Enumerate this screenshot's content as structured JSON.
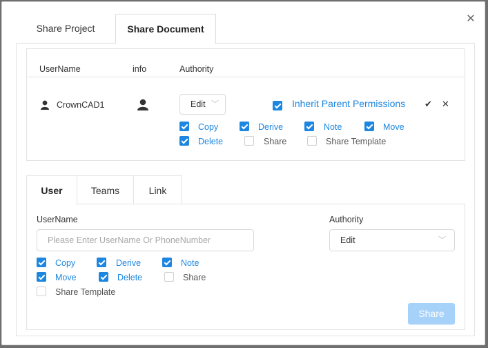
{
  "dialog": {
    "close_icon": "close-icon",
    "tabs": [
      "Share Project",
      "Share Document"
    ],
    "active_tab": "Share Document"
  },
  "permissions_table": {
    "headers": {
      "username": "UserName",
      "info": "info",
      "authority": "Authority"
    },
    "row": {
      "username": "CrownCAD1",
      "authority": "Edit",
      "inherit_label": "Inherit Parent Permissions",
      "inherit_checked": true,
      "checkboxes": [
        {
          "label": "Copy",
          "checked": true
        },
        {
          "label": "Derive",
          "checked": true
        },
        {
          "label": "Note",
          "checked": true
        },
        {
          "label": "Move",
          "checked": true
        },
        {
          "label": "Delete",
          "checked": true
        },
        {
          "label": "Share",
          "checked": false
        },
        {
          "label": "Share Template",
          "checked": false
        }
      ]
    }
  },
  "share_form": {
    "tabs": [
      "User",
      "Teams",
      "Link"
    ],
    "active_tab": "User",
    "username_label": "UserName",
    "username_placeholder": "Please Enter UserName Or PhoneNumber",
    "username_value": "",
    "authority_label": "Authority",
    "authority_value": "Edit",
    "checkboxes": [
      {
        "label": "Copy",
        "checked": true
      },
      {
        "label": "Derive",
        "checked": true
      },
      {
        "label": "Note",
        "checked": true
      },
      {
        "label": "Move",
        "checked": true
      },
      {
        "label": "Delete",
        "checked": true
      },
      {
        "label": "Share",
        "checked": false
      },
      {
        "label": "Share Template",
        "checked": false
      }
    ],
    "share_button": "Share"
  },
  "colors": {
    "accent": "#1c86e0",
    "disabled_button": "#a6d2f9",
    "backdrop": "#6f6f6f"
  }
}
